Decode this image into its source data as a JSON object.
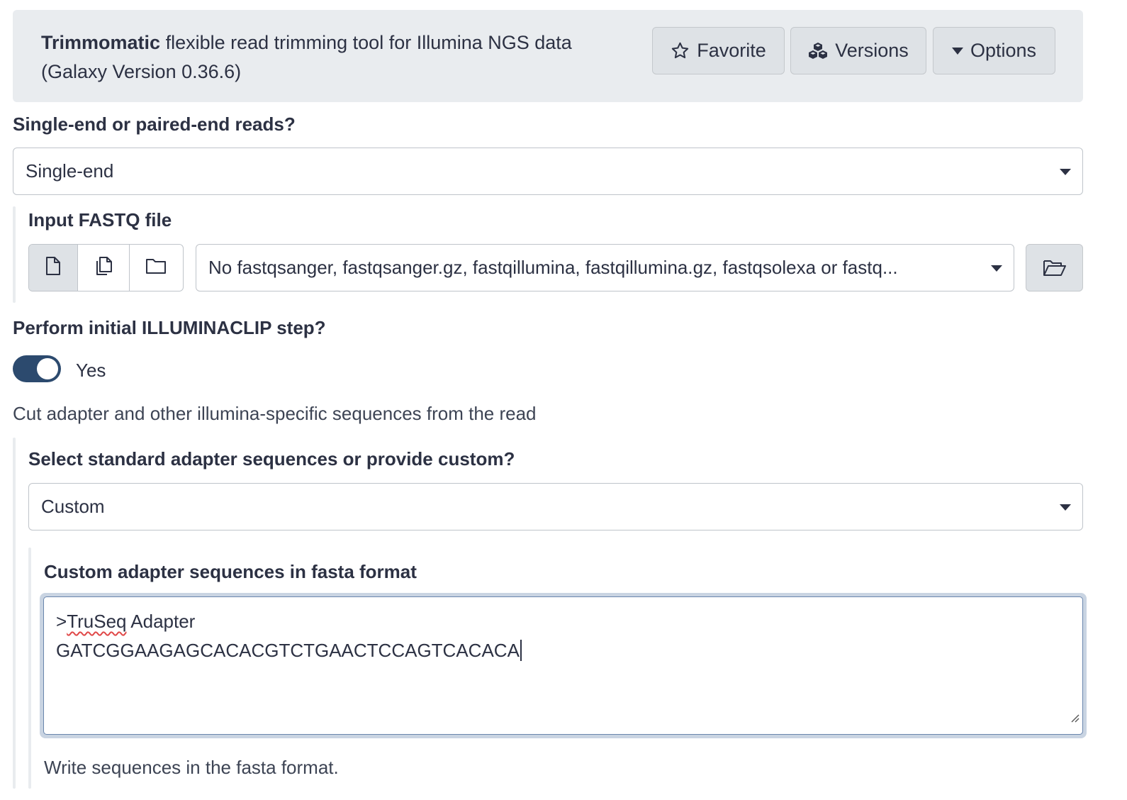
{
  "header": {
    "tool_name": "Trimmomatic",
    "description": " flexible read trimming tool for Illumina NGS data",
    "version": "(Galaxy Version 0.36.6)",
    "buttons": {
      "favorite": "Favorite",
      "versions": "Versions",
      "options": "Options"
    }
  },
  "read_type": {
    "label": "Single-end or paired-end reads?",
    "value": "Single-end"
  },
  "input_fastq": {
    "label": "Input FASTQ file",
    "value": "No fastqsanger, fastqsanger.gz, fastqillumina, fastqillumina.gz, fastqsolexa or fastq..."
  },
  "illuminaclip": {
    "label": "Perform initial ILLUMINACLIP step?",
    "toggle_on": true,
    "toggle_label": "Yes",
    "help": "Cut adapter and other illumina-specific sequences from the read"
  },
  "adapter_source": {
    "label": "Select standard adapter sequences or provide custom?",
    "value": "Custom"
  },
  "custom_adapters": {
    "label": "Custom adapter sequences in fasta format",
    "line1_prefix": ">",
    "line1_word": "TruSeq",
    "line1_rest": " Adapter",
    "line2": "GATCGGAAGAGCACACGTCTGAACTCCAGTCACACA",
    "help": "Write sequences in the fasta format."
  },
  "colors": {
    "accent": "#2c4a6e",
    "header_bg": "#e9ecef",
    "text": "#2c3143"
  }
}
